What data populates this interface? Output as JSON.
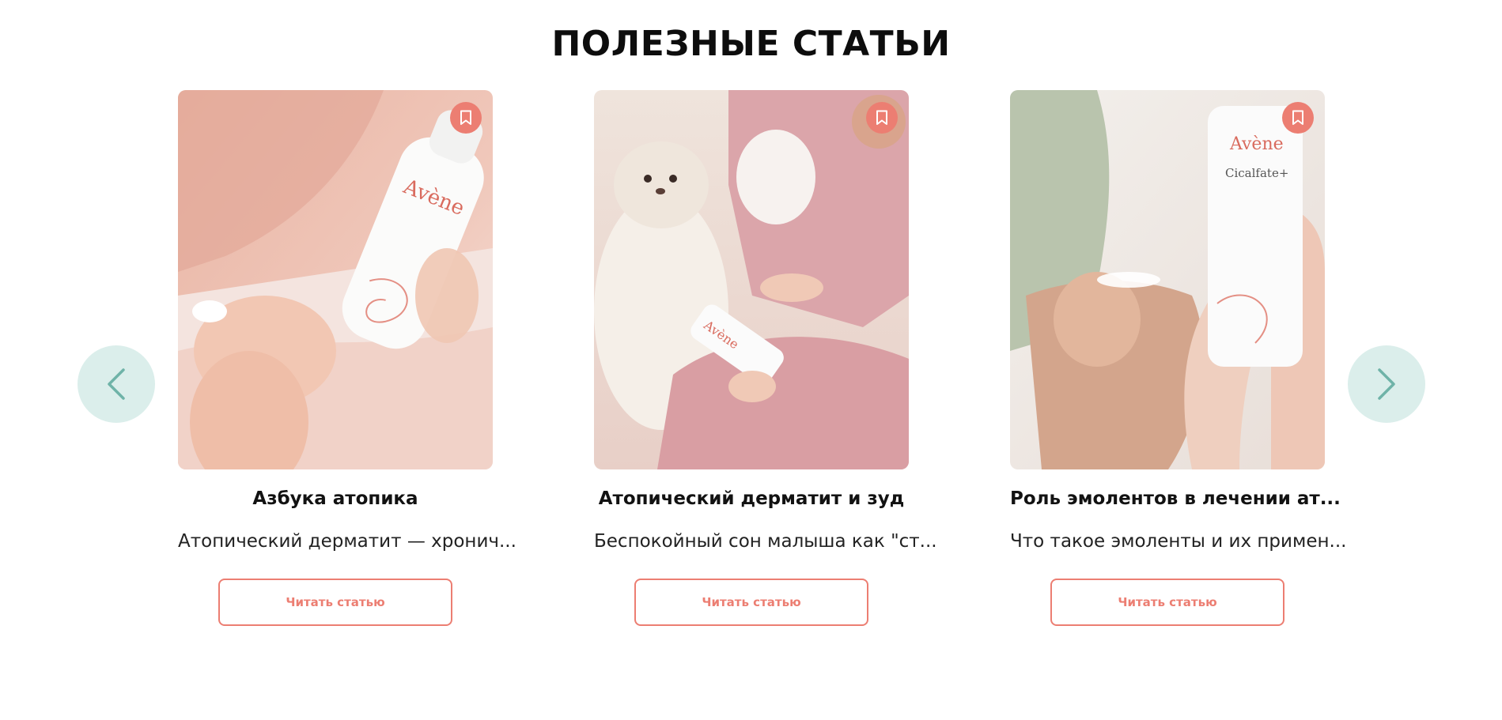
{
  "section": {
    "title": "ПОЛЕЗНЫЕ СТАТЬИ"
  },
  "navigation": {
    "prev_icon": "chevron-left-icon",
    "next_icon": "chevron-right-icon",
    "accent_color": "#dbeeeb",
    "arrow_color": "#6fb3a8"
  },
  "cards": [
    {
      "title": "Азбука атопика",
      "excerpt": "Атопический дерматит — хронич...",
      "button_label": "Читать статью",
      "bookmark_icon": "bookmark-icon",
      "image_subject": "child hands holding Avène XeraCalm A.D bottle on pink bedding"
    },
    {
      "title": "Атопический дерматит и зуд",
      "excerpt": "Беспокойный сон малыша как \"ст...",
      "button_label": "Читать статью",
      "bookmark_icon": "bookmark-icon",
      "image_subject": "toddler in pink overalls applying cream next to teddy bunny"
    },
    {
      "title": "Роль эмолентов в лечении ат...",
      "excerpt": "Что такое эмоленты и их примен...",
      "button_label": "Читать статью",
      "bookmark_icon": "bookmark-icon",
      "image_subject": "adult hand holding Avène Cicalfate+ tube next to child arm"
    }
  ],
  "colors": {
    "accent": "#ec7e72",
    "text": "#121212",
    "background": "#ffffff"
  }
}
